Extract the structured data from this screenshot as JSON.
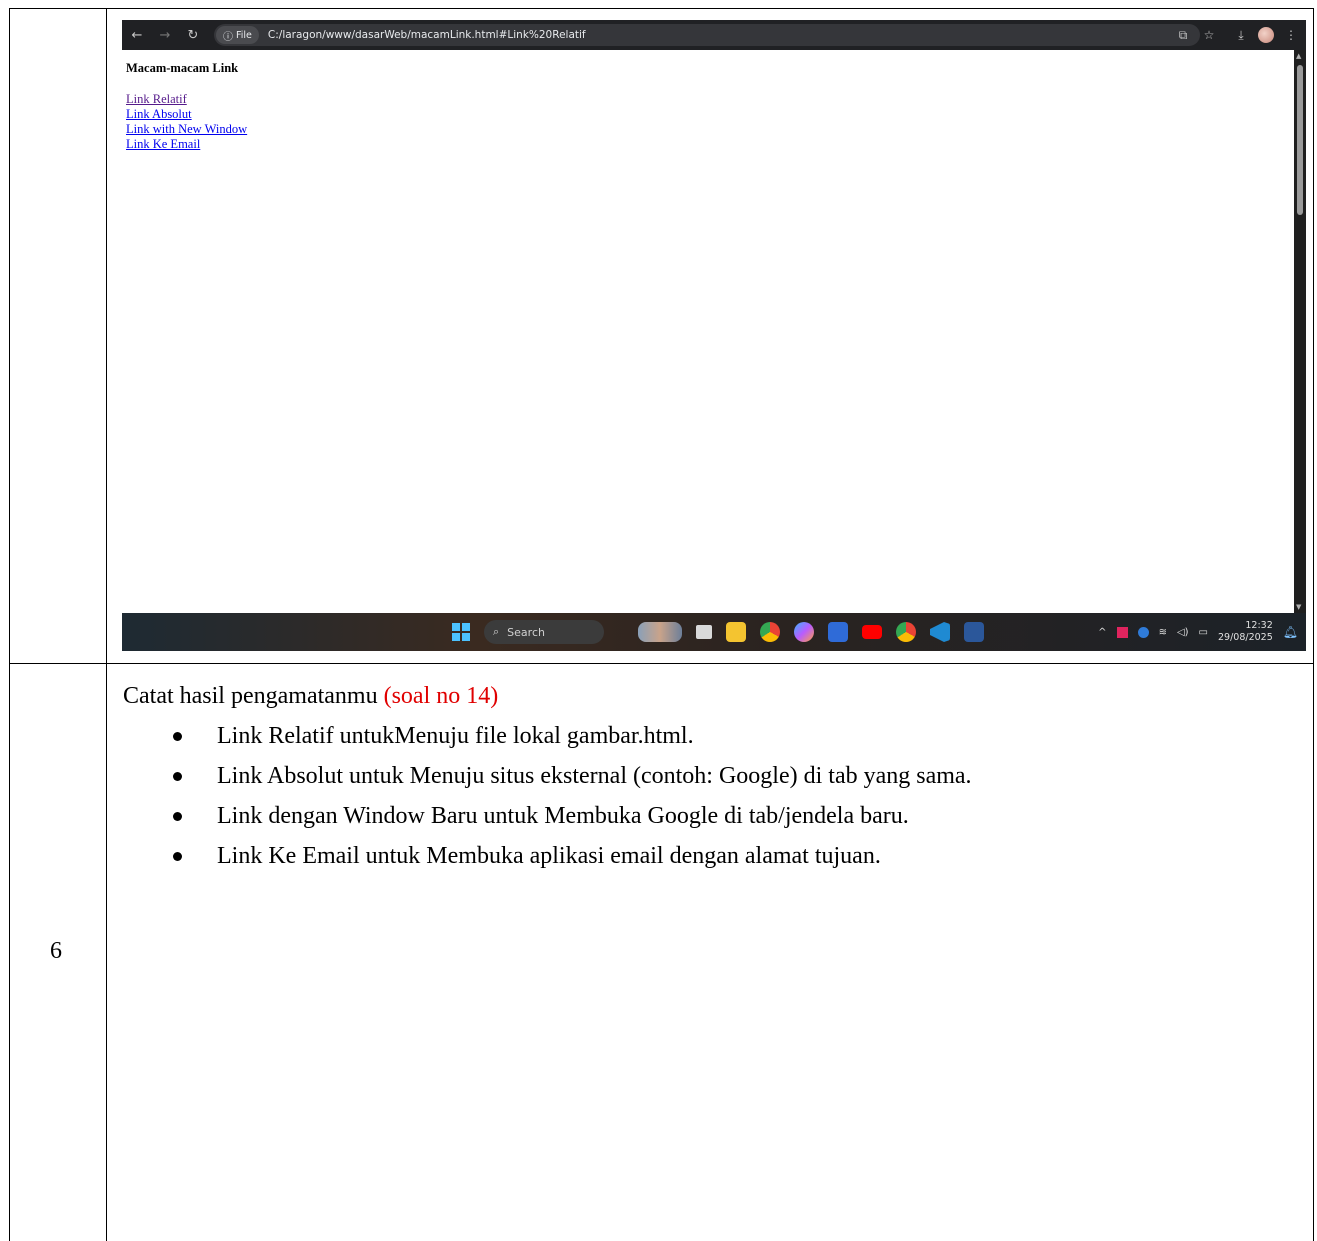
{
  "browser": {
    "chip_label": "File",
    "url": "C:/laragon/www/dasarWeb/macamLink.html#Link%20Relatif"
  },
  "page": {
    "heading": "Macam-macam Link",
    "links": [
      {
        "label": "Link Relatif",
        "color": "#551a8b"
      },
      {
        "label": "Link Absolut",
        "color": "#0000ee"
      },
      {
        "label": "Link with New Window",
        "color": "#0000ee"
      },
      {
        "label": "Link Ke Email",
        "color": "#0000ee"
      }
    ]
  },
  "taskbar": {
    "search_label": "Search",
    "time": "12:32",
    "date": "29/08/2025"
  },
  "table": {
    "row_number": "6",
    "notes_title": "Catat hasil pengamatanmu",
    "notes_title_red": "(soal no 14)",
    "bullets": [
      "Link Relatif  untukMenuju file lokal gambar.html.",
      "Link Absolut untuk Menuju situs eksternal (contoh: Google) di tab yang sama.",
      "Link dengan Window Baru untuk Membuka Google di tab/jendela baru.",
      "Link Ke Email untuk Membuka aplikasi email dengan alamat tujuan."
    ]
  }
}
